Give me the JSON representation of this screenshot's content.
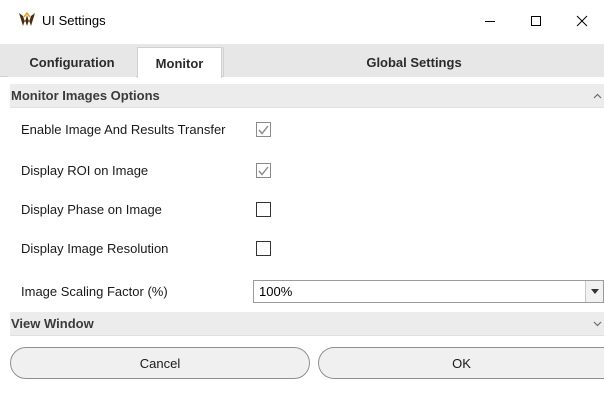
{
  "window": {
    "title": "UI Settings",
    "icons": {
      "app": "app-logo-icon",
      "minimize": "minimize-icon",
      "maximize": "maximize-icon",
      "close": "close-icon"
    }
  },
  "tabs": [
    {
      "label": "Configuration",
      "active": false
    },
    {
      "label": "Monitor",
      "active": true
    },
    {
      "label": "Global Settings",
      "active": false
    }
  ],
  "sections": {
    "monitor_images": {
      "title": "Monitor Images Options",
      "expanded": true
    },
    "view_window": {
      "title": "View Window",
      "expanded": false
    }
  },
  "options": [
    {
      "label": "Enable Image And Results Transfer",
      "checked": true
    },
    {
      "label": "Display ROI on Image",
      "checked": true
    },
    {
      "label": "Display Phase on Image",
      "checked": false
    },
    {
      "label": "Display Image Resolution",
      "checked": false
    }
  ],
  "scaling": {
    "label": "Image Scaling Factor (%)",
    "value": "100%"
  },
  "buttons": {
    "cancel": "Cancel",
    "ok": "OK"
  },
  "colors": {
    "tab_bar": "#e7e7e7",
    "section_header": "#ececec",
    "button_bg": "#f0f0f0",
    "checkmark": "#8a8a8a"
  }
}
